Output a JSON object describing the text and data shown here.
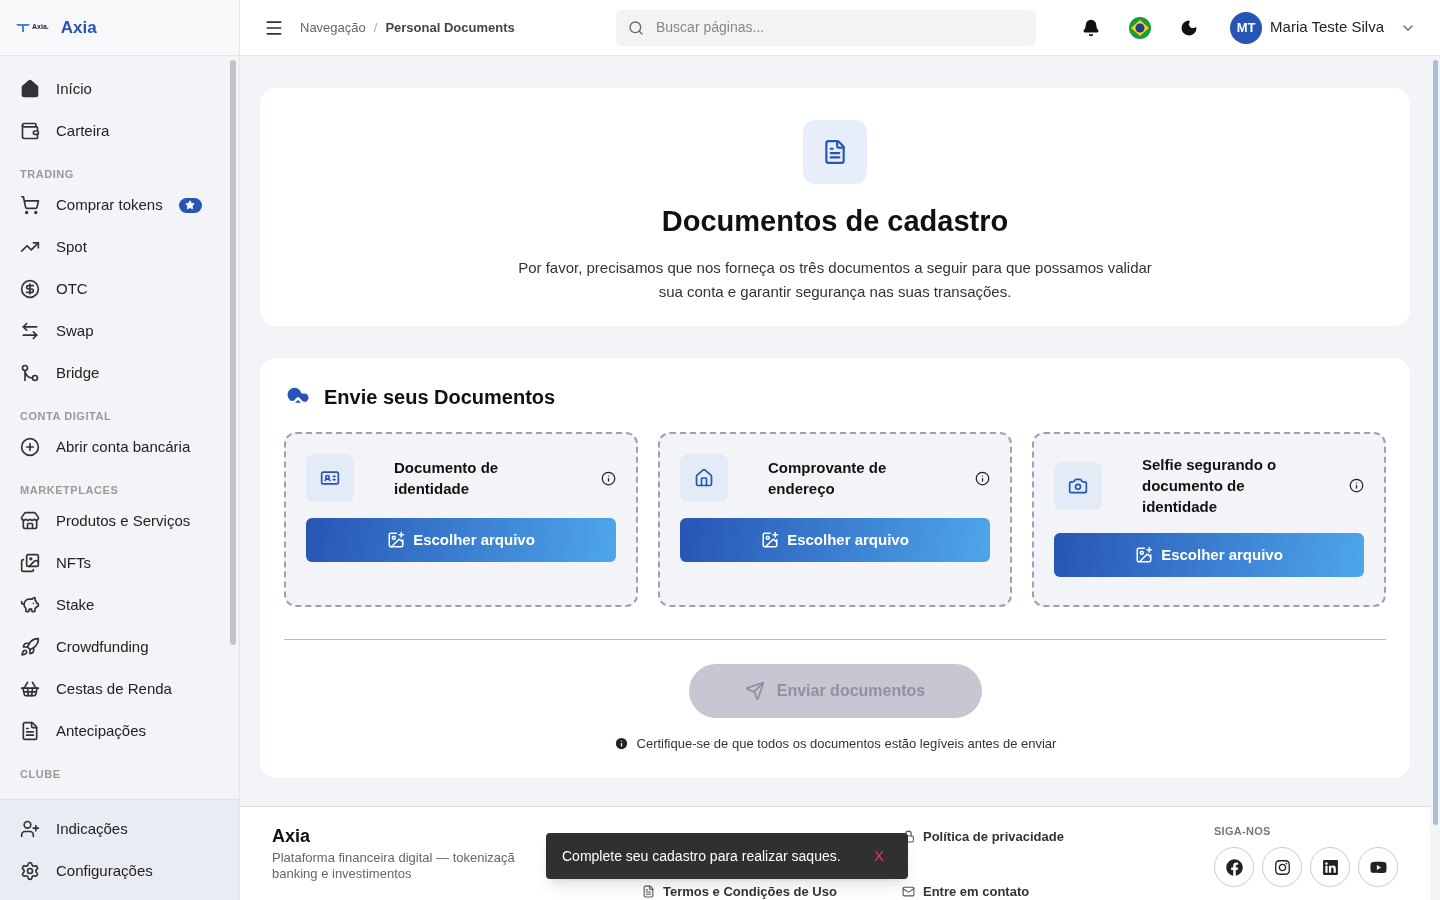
{
  "sidebar": {
    "logo_text": "Axia.",
    "brand": "Axia",
    "sections": [
      {
        "items": [
          {
            "label": "Início"
          },
          {
            "label": "Carteira"
          }
        ]
      },
      {
        "title": "TRADING",
        "items": [
          {
            "label": "Comprar tokens",
            "badge": true
          },
          {
            "label": "Spot"
          },
          {
            "label": "OTC"
          },
          {
            "label": "Swap"
          },
          {
            "label": "Bridge"
          }
        ]
      },
      {
        "title": "CONTA DIGITAL",
        "items": [
          {
            "label": "Abrir conta bancária"
          }
        ]
      },
      {
        "title": "MARKETPLACES",
        "items": [
          {
            "label": "Produtos e Serviços"
          },
          {
            "label": "NFTs"
          },
          {
            "label": "Stake"
          },
          {
            "label": "Crowdfunding"
          },
          {
            "label": "Cestas de Renda"
          },
          {
            "label": "Antecipações"
          }
        ]
      },
      {
        "title": "CLUBE"
      }
    ],
    "bottom_items": [
      {
        "label": "Indicações"
      },
      {
        "label": "Configurações"
      }
    ]
  },
  "header": {
    "breadcrumb": [
      "Navegação",
      "Personal Documents"
    ],
    "breadcrumb_separator": "/",
    "search": {
      "placeholder": "Buscar páginas..."
    },
    "user": {
      "initials": "MT",
      "name": "Maria Teste Silva"
    }
  },
  "intro": {
    "title": "Documentos de cadastro",
    "text": "Por favor, precisamos que nos forneça os três documentos a seguir para que possamos validar sua conta e garantir segurança nas suas transações."
  },
  "upload": {
    "title": "Envie seus Documentos",
    "documents": [
      {
        "label": "Documento de identidade",
        "button": "Escolher arquivo"
      },
      {
        "label": "Comprovante de endereço",
        "button": "Escolher arquivo"
      },
      {
        "label": "Selfie segurando o documento de identidade",
        "button": "Escolher arquivo"
      }
    ],
    "send_button": {
      "label": "Enviar documentos",
      "disabled": true
    },
    "note": "Certifique-se de que todos os documentos estão legíveis antes de enviar"
  },
  "footer": {
    "brand": "Axia",
    "description": [
      "Plataforma financeira digital — tokenizaçã",
      "banking e investimentos"
    ],
    "links": [
      {
        "label": "Política de privacidade"
      },
      {
        "label": "Termos e Condições de Uso"
      },
      {
        "label": "Entre em contato"
      }
    ],
    "social_title": "SIGA-NOS"
  },
  "toast": {
    "message": "Complete seu cadastro para realizar saques.",
    "close": "X"
  }
}
